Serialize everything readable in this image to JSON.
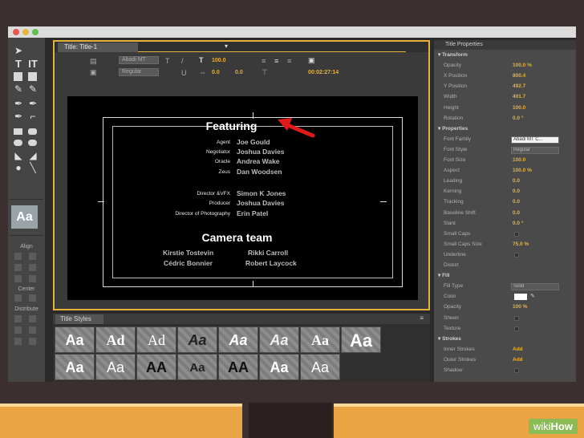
{
  "title_panel": {
    "tab_label": "Title: Title-1"
  },
  "toolbar": {
    "font_family": "Abadi MT",
    "font_style": "Regular",
    "size": "100.0",
    "kerning": "0.0",
    "leading": "0.0",
    "timecode": "00:02:27:14",
    "bold_icon": "T",
    "underline_icon": "U"
  },
  "credits": {
    "featuring": "Featuring",
    "cast": [
      {
        "role": "Agent",
        "name": "Joe Gould"
      },
      {
        "role": "Negotiator",
        "name": "Joshua Davies"
      },
      {
        "role": "Oracle",
        "name": "Andrea Wake"
      },
      {
        "role": "Zeus",
        "name": "Dan Woodsen"
      }
    ],
    "crew": [
      {
        "role": "Director &VFX",
        "name": "Simon K Jones"
      },
      {
        "role": "Producer",
        "name": "Joshua Davies"
      },
      {
        "role": "Director of Photography",
        "name": "Erin Patel"
      }
    ],
    "camera_team_heading": "Camera team",
    "camera_team": [
      [
        "Kirstie Tostevin",
        "Rikki Carroll"
      ],
      [
        "Cédric Bonnier",
        "Robert Laycock"
      ]
    ]
  },
  "left_tools": {
    "align_label": "Align",
    "center_label": "Center",
    "distribute_label": "Distribute",
    "style_preview": "Aa"
  },
  "title_styles": {
    "tab_label": "Title Styles",
    "menu_icon": "≡",
    "swatches": [
      "Aa",
      "Ad",
      "Ad",
      "Aa",
      "Aa",
      "Aa",
      "Aa",
      "Aa",
      "Aa",
      "Aa",
      "AA",
      "Aa",
      "AA",
      "Aa",
      "Aa"
    ]
  },
  "properties": {
    "header": "Title Properties",
    "rows": [
      {
        "label": "Transform",
        "section": true
      },
      {
        "label": "Opacity",
        "value": "100.0 %"
      },
      {
        "label": "X Position",
        "value": "800.4"
      },
      {
        "label": "Y Position",
        "value": "492.7"
      },
      {
        "label": "Width",
        "value": "401.7"
      },
      {
        "label": "Height",
        "value": "100.0"
      },
      {
        "label": "Rotation",
        "value": "0.0 °"
      },
      {
        "label": "Properties",
        "section": true
      },
      {
        "label": "Font Family",
        "dropdown": "Abadi MT C..."
      },
      {
        "label": "Font Style",
        "dropdown": "Regular"
      },
      {
        "label": "Font Size",
        "value": "100.0"
      },
      {
        "label": "Aspect",
        "value": "100.0 %"
      },
      {
        "label": "Leading",
        "value": "0.0"
      },
      {
        "label": "Kerning",
        "value": "0.0"
      },
      {
        "label": "Tracking",
        "value": "0.0"
      },
      {
        "label": "Baseline Shift",
        "value": "0.0"
      },
      {
        "label": "Slant",
        "value": "0.0 °"
      },
      {
        "label": "Small Caps",
        "check": true
      },
      {
        "label": "Small Caps Size",
        "value": "75.0 %"
      },
      {
        "label": "Underline",
        "check": true
      },
      {
        "label": "Distort",
        "section": false
      },
      {
        "label": "Fill",
        "section": true
      },
      {
        "label": "Fill Type",
        "dropdown": "Solid"
      },
      {
        "label": "Color",
        "swatch": true
      },
      {
        "label": "Opacity",
        "value": "100 %"
      },
      {
        "label": "Sheen",
        "check": true
      },
      {
        "label": "Texture",
        "check": true
      },
      {
        "label": "Strokes",
        "section": true
      },
      {
        "label": "Inner Strokes",
        "value": "Add"
      },
      {
        "label": "Outer Strokes",
        "value": "Add"
      },
      {
        "label": "Shadow",
        "check": true
      }
    ]
  },
  "watermark": {
    "wiki": "wiki",
    "how": "How"
  }
}
